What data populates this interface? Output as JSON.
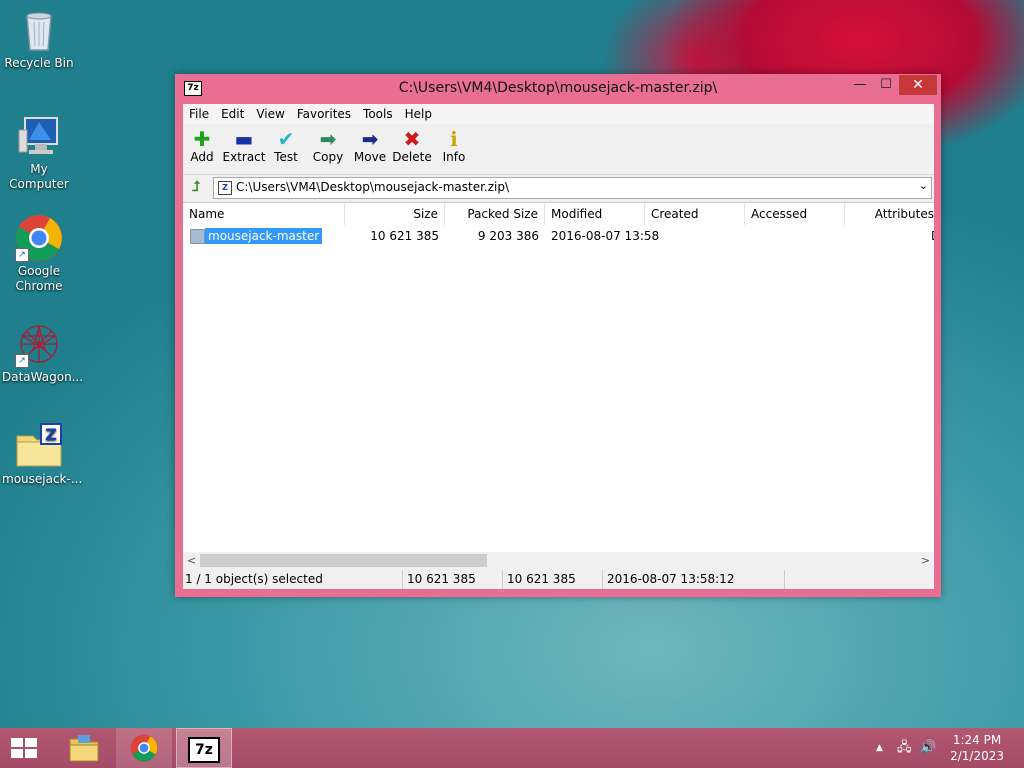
{
  "desktop": {
    "icons": [
      {
        "label": "Recycle Bin",
        "icon": "recycle-bin-icon"
      },
      {
        "label": "My Computer",
        "icon": "computer-icon"
      },
      {
        "label": "Google Chrome",
        "icon": "chrome-icon"
      },
      {
        "label": "DataWagon...",
        "icon": "datawagon-icon"
      },
      {
        "label": "mousejack-...",
        "icon": "zip-folder-icon"
      }
    ]
  },
  "window": {
    "title": "C:\\Users\\VM4\\Desktop\\mousejack-master.zip\\",
    "app_icon_text": "7z",
    "controls": {
      "minimize": "—",
      "maximize": "☐",
      "close": "✕"
    },
    "menu": [
      "File",
      "Edit",
      "View",
      "Favorites",
      "Tools",
      "Help"
    ],
    "toolbar": [
      {
        "label": "Add",
        "icon": "add-icon",
        "glyph": "✚",
        "color": "#1aa31a"
      },
      {
        "label": "Extract",
        "icon": "extract-icon",
        "glyph": "▬",
        "color": "#1b2fa8"
      },
      {
        "label": "Test",
        "icon": "test-icon",
        "glyph": "✔",
        "color": "#28b6c8"
      },
      {
        "label": "Copy",
        "icon": "copy-icon",
        "glyph": "➡",
        "color": "#2d8c5a"
      },
      {
        "label": "Move",
        "icon": "move-icon",
        "glyph": "➡",
        "color": "#1c2c8c"
      },
      {
        "label": "Delete",
        "icon": "delete-icon",
        "glyph": "✖",
        "color": "#d01818"
      },
      {
        "label": "Info",
        "icon": "info-icon",
        "glyph": "ℹ",
        "color": "#c8a800"
      }
    ],
    "address": {
      "icon_text": "Z",
      "path": "C:\\Users\\VM4\\Desktop\\mousejack-master.zip\\"
    },
    "columns": [
      "Name",
      "Size",
      "Packed Size",
      "Modified",
      "Created",
      "Accessed",
      "Attributes"
    ],
    "rows": [
      {
        "name": "mousejack-master",
        "size": "10 621 385",
        "packed_size": "9 203 386",
        "modified": "2016-08-07 13:58",
        "created": "",
        "accessed": "",
        "attributes": "D",
        "selected": true
      }
    ],
    "scroll": {
      "left": "<",
      "right": ">"
    },
    "status": {
      "selection": "1 / 1 object(s) selected",
      "size": "10 621 385",
      "packed": "10 621 385",
      "modified": "2016-08-07 13:58:12"
    }
  },
  "taskbar": {
    "clock_time": "1:24 PM",
    "clock_date": "2/1/2023",
    "tray_up_arrow": "▲",
    "volume_glyph": "🔊",
    "network_glyph": "🖧",
    "app_7z_label": "7z"
  }
}
